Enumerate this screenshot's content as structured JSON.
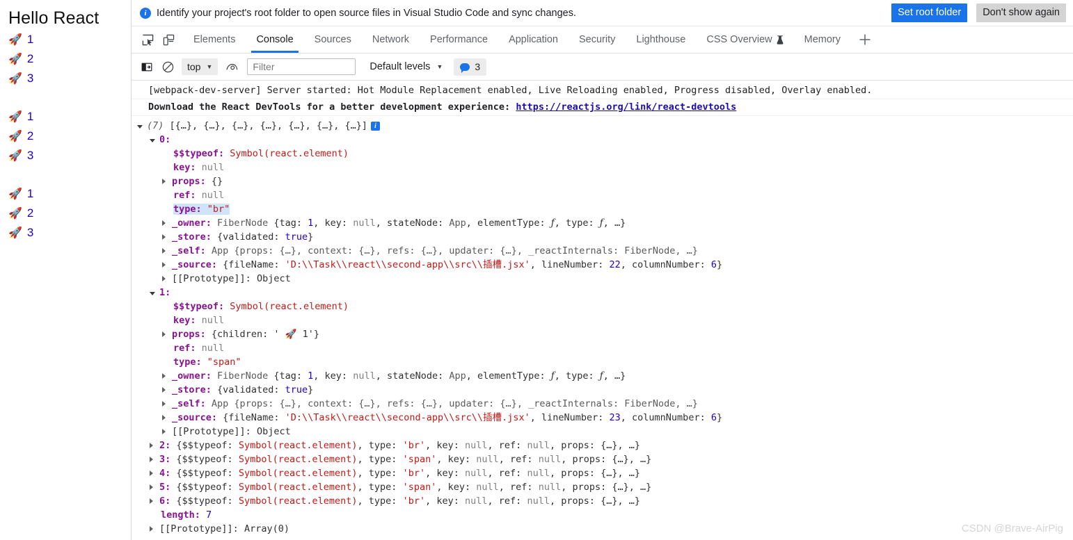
{
  "page": {
    "title": "Hello React",
    "groups": [
      {
        "items": [
          {
            "icon": "rocket-icon",
            "label": "1"
          },
          {
            "icon": "rocket-icon",
            "label": "2"
          },
          {
            "icon": "rocket-icon",
            "label": "3"
          }
        ]
      },
      {
        "items": [
          {
            "icon": "rocket-icon",
            "label": "1"
          },
          {
            "icon": "rocket-icon",
            "label": "2"
          },
          {
            "icon": "rocket-icon",
            "label": "3"
          }
        ]
      },
      {
        "items": [
          {
            "icon": "rocket-icon",
            "label": "1"
          },
          {
            "icon": "rocket-icon",
            "label": "2"
          },
          {
            "icon": "rocket-icon",
            "label": "3"
          }
        ]
      }
    ],
    "rocket_glyph": "🚀"
  },
  "notification": {
    "icon": "info-icon",
    "message": "Identify your project's root folder to open source files in Visual Studio Code and sync changes.",
    "primary_button": "Set root folder",
    "secondary_button": "Don't show again",
    "primary_color": "#1a73e8"
  },
  "tabstrip": {
    "left_icons": [
      {
        "name": "inspect-element-icon"
      },
      {
        "name": "device-toolbar-icon"
      }
    ],
    "tabs": [
      {
        "label": "Elements",
        "active": false
      },
      {
        "label": "Console",
        "active": true
      },
      {
        "label": "Sources",
        "active": false
      },
      {
        "label": "Network",
        "active": false
      },
      {
        "label": "Performance",
        "active": false
      },
      {
        "label": "Application",
        "active": false
      },
      {
        "label": "Security",
        "active": false
      },
      {
        "label": "Lighthouse",
        "active": false
      },
      {
        "label": "CSS Overview",
        "active": false,
        "badge": "experiment-flask-icon"
      },
      {
        "label": "Memory",
        "active": false
      }
    ],
    "more_tabs": "+",
    "active_underline_color": "#1a73e8"
  },
  "console_toolbar": {
    "sidebar_toggle_icon": "console-sidebar-icon",
    "clear_icon": "clear-console-icon",
    "context_selector": "top",
    "eye_icon": "live-expression-icon",
    "filter_placeholder": "Filter",
    "filter_value": "",
    "levels_label": "Default levels",
    "message_count": "3",
    "message_icon": "info-message-icon"
  },
  "console": {
    "messages": [
      {
        "text": "[webpack-dev-server] Server started: Hot Module Replacement enabled, Live Reloading enabled, Progress disabled, Overlay enabled.",
        "bold": false
      }
    ],
    "devtools_message": {
      "prefix": "Download the React DevTools for a better development experience: ",
      "link": "https://reactjs.org/link/react-devtools"
    },
    "array_header": {
      "count": "(7)",
      "preview": "[{…}, {…}, {…}, {…}, {…}, {…}, {…}]",
      "badge": "i"
    },
    "entry0": {
      "index": "0:",
      "typeof_key": "$$typeof:",
      "typeof_value": "Symbol(react.element)",
      "key_key": "key:",
      "key_value": "null",
      "props_key": "props:",
      "props_value": "{}",
      "ref_key": "ref:",
      "ref_value": "null",
      "type_key": "type:",
      "type_value": "\"br\"",
      "owner_key": "_owner:",
      "owner_class": "FiberNode",
      "owner_tag_k": "{tag:",
      "owner_tag_v": "1",
      "owner_key_k": ", key:",
      "owner_key_v": "null",
      "owner_state_k": ", stateNode:",
      "owner_state_v": "App",
      "owner_elem_k": ", elementType:",
      "owner_elem_v": "ƒ",
      "owner_type_k": ", type:",
      "owner_type_v": "ƒ",
      "owner_tail": ", …}",
      "store_key": "_store:",
      "store_pre": "{validated:",
      "store_val": "true",
      "store_post": "}",
      "self_key": "_self:",
      "self_value": "App {props: {…}, context: {…}, refs: {…}, updater: {…}, _reactInternals: FiberNode, …}",
      "source_key": "_source:",
      "source_pre": "{fileName:",
      "source_file": "'D:\\\\Task\\\\react\\\\second-app\\\\src\\\\插槽.jsx'",
      "source_line_k": ", lineNumber:",
      "source_line_v": "22",
      "source_col_k": ", columnNumber:",
      "source_col_v": "6",
      "source_post": "}",
      "proto_key": "[[Prototype]]:",
      "proto_value": "Object"
    },
    "entry1": {
      "index": "1:",
      "typeof_key": "$$typeof:",
      "typeof_value": "Symbol(react.element)",
      "key_key": "key:",
      "key_value": "null",
      "props_key": "props:",
      "props_pre": "{children: '",
      "props_rocket": "🚀",
      "props_post": "1'}",
      "ref_key": "ref:",
      "ref_value": "null",
      "type_key": "type:",
      "type_value": "\"span\"",
      "owner_key": "_owner:",
      "owner_class": "FiberNode",
      "owner_tag_k": "{tag:",
      "owner_tag_v": "1",
      "owner_key_k": ", key:",
      "owner_key_v": "null",
      "owner_state_k": ", stateNode:",
      "owner_state_v": "App",
      "owner_elem_k": ", elementType:",
      "owner_elem_v": "ƒ",
      "owner_type_k": ", type:",
      "owner_type_v": "ƒ",
      "owner_tail": ", …}",
      "store_key": "_store:",
      "store_pre": "{validated:",
      "store_val": "true",
      "store_post": "}",
      "self_key": "_self:",
      "self_value": "App {props: {…}, context: {…}, refs: {…}, updater: {…}, _reactInternals: FiberNode, …}",
      "source_key": "_source:",
      "source_pre": "{fileName:",
      "source_file": "'D:\\\\Task\\\\react\\\\second-app\\\\src\\\\插槽.jsx'",
      "source_line_k": ", lineNumber:",
      "source_line_v": "23",
      "source_col_k": ", columnNumber:",
      "source_col_v": "6",
      "source_post": "}",
      "proto_key": "[[Prototype]]:",
      "proto_value": "Object"
    },
    "collapsed": [
      {
        "index": "2:",
        "typeof": "Symbol(react.element)",
        "type": "'br'"
      },
      {
        "index": "3:",
        "typeof": "Symbol(react.element)",
        "type": "'span'"
      },
      {
        "index": "4:",
        "typeof": "Symbol(react.element)",
        "type": "'br'"
      },
      {
        "index": "5:",
        "typeof": "Symbol(react.element)",
        "type": "'span'"
      },
      {
        "index": "6:",
        "typeof": "Symbol(react.element)",
        "type": "'br'"
      }
    ],
    "collapsed_tokens": {
      "open": "{$$typeof:",
      "type_k": ", type:",
      "key_k": ", key:",
      "key_v": "null",
      "ref_k": ", ref:",
      "ref_v": "null",
      "props_k": ", props:",
      "props_v": "{…}",
      "tail": ", …}"
    },
    "length_key": "length:",
    "length_value": "7",
    "array_proto_key": "[[Prototype]]:",
    "array_proto_value": "Array(0)"
  },
  "watermark": "CSDN @Brave-AirPig"
}
